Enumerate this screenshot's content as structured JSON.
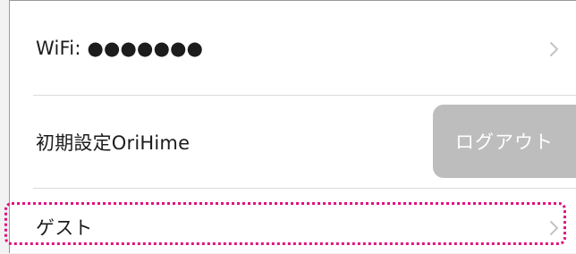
{
  "settings": {
    "wifi": {
      "label": "WiFi: ●●●●●●●",
      "chevron_icon": "chevron-right-icon"
    },
    "device": {
      "label": "初期設定OriHime",
      "logout_label": "ログアウト",
      "logout_color": "#bdbdbd"
    },
    "guest": {
      "label": "ゲスト",
      "chevron_icon": "chevron-right-icon"
    }
  },
  "highlight": {
    "color": "#e0127e",
    "style": "dotted"
  }
}
